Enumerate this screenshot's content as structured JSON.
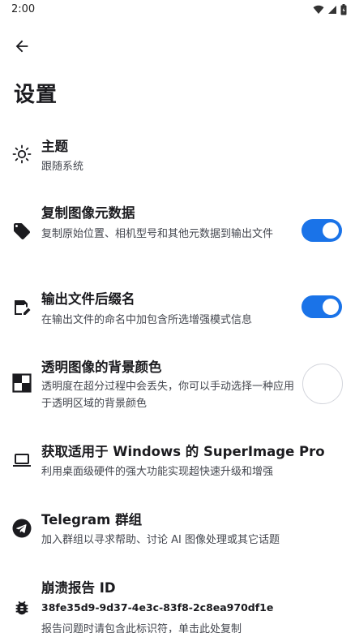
{
  "status_bar": {
    "time": "2:00",
    "icons": [
      "wifi-icon",
      "signal-icon",
      "battery-icon"
    ]
  },
  "header": {
    "back_icon": "arrow-left-icon",
    "title": "设置"
  },
  "settings": [
    {
      "key": "theme",
      "icon": "sun-icon",
      "title": "主题",
      "description": "跟随系统",
      "control": "none"
    },
    {
      "key": "copy-metadata",
      "icon": "tag-icon",
      "title": "复制图像元数据",
      "description": "复制原始位置、相机型号和其他元数据到输出文件",
      "control": "switch",
      "enabled": true
    },
    {
      "key": "output-suffix",
      "icon": "file-edit-icon",
      "title": "输出文件后缀名",
      "description": "在输出文件的命名中加包含所选增强模式信息",
      "control": "switch",
      "enabled": true
    },
    {
      "key": "transparent-bg",
      "icon": "checkerboard-icon",
      "title": "透明图像的背景颜色",
      "description": "透明度在超分过程中会丢失，你可以手动选择一种应用于透明区域的背景颜色",
      "control": "color",
      "color": "#ffffff"
    },
    {
      "key": "windows-pro",
      "icon": "laptop-icon",
      "title": "获取适用于 Windows 的 SuperImage Pro",
      "description": "利用桌面级硬件的强大功能实现超快速升级和增强",
      "control": "none"
    },
    {
      "key": "telegram",
      "icon": "telegram-icon",
      "title": "Telegram 群组",
      "description": "加入群组以寻求帮助、讨论 AI 图像处理或其它话题",
      "control": "none"
    },
    {
      "key": "crash-report",
      "icon": "bug-icon",
      "title": "崩溃报告 ID",
      "value": "38fe35d9-9d37-4e3c-83f8-2c8ea970df1e",
      "description": "报告问题时请包含此标识符，单击此处复制",
      "control": "none"
    }
  ],
  "colors": {
    "switch_on": "#1a73e8",
    "text_primary": "#1b1b1f",
    "text_secondary": "#44474f"
  }
}
